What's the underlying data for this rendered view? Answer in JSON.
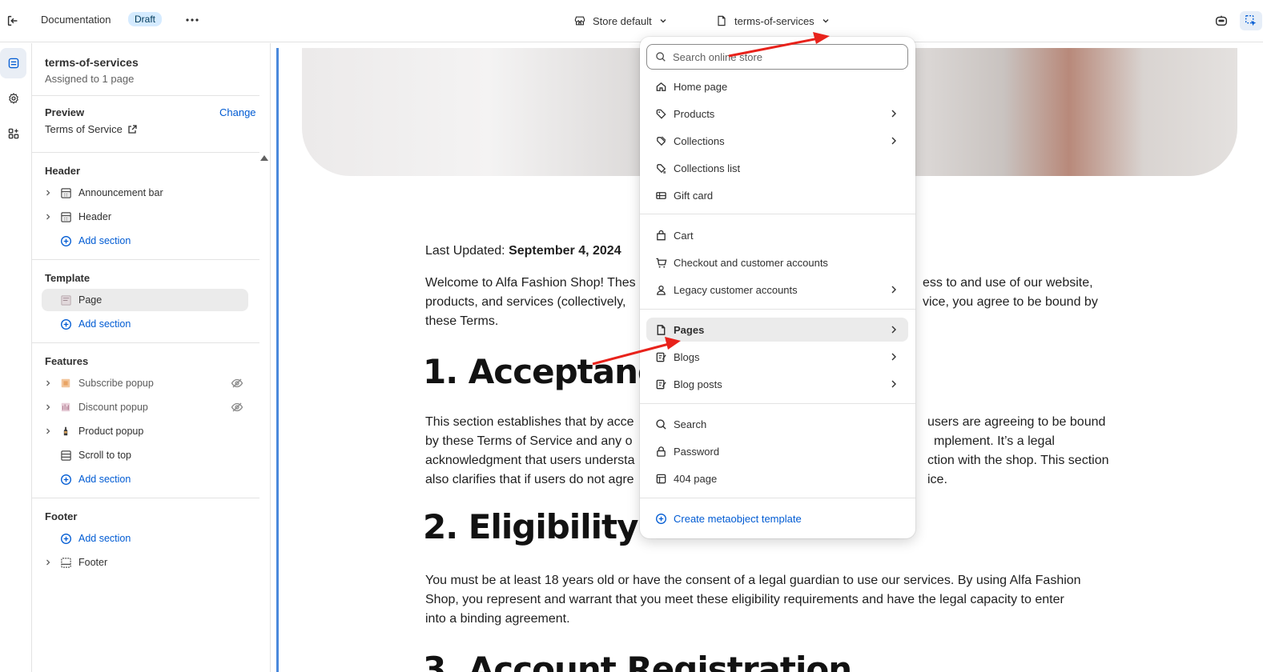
{
  "topbar": {
    "theme_name": "Documentation",
    "status_badge": "Draft",
    "store_select": "Store default",
    "template_select": "terms-of-services"
  },
  "sidebar": {
    "template_title": "terms-of-services",
    "assigned": "Assigned to 1 page",
    "preview_label": "Preview",
    "preview_change": "Change",
    "preview_page": "Terms of Service",
    "header_group": {
      "title": "Header",
      "items": [
        "Announcement bar",
        "Header"
      ],
      "add_label": "Add section"
    },
    "template_group": {
      "title": "Template",
      "items": [
        "Page"
      ],
      "add_label": "Add section"
    },
    "features_group": {
      "title": "Features",
      "items": [
        "Subscribe popup",
        "Discount popup",
        "Product popup",
        "Scroll to top"
      ],
      "add_label": "Add section"
    },
    "footer_group": {
      "title": "Footer",
      "add_label": "Add section",
      "items": [
        "Footer"
      ]
    }
  },
  "preview": {
    "last_updated_label": "Last Updated:",
    "last_updated_date": "September 4, 2024",
    "intro_1": "Welcome to Alfa Fashion Shop! Thes",
    "intro_1b": "ess to and use of our website,",
    "intro_2": "products, and services (collectively,",
    "intro_2b": "vice, you agree to be bound by",
    "intro_3": "these Terms.",
    "heading_1": "1. Acceptanc",
    "s1_l1": "This section establishes that by acce",
    "s1_l1b": "users are agreeing to be bound",
    "s1_l2": "by these Terms of Service and any o",
    "s1_l2b": "mplement. It’s a legal",
    "s1_l3": "acknowledgment that users understa",
    "s1_l3b": "ction with the shop. This section",
    "s1_l4": "also clarifies that if users do not agre",
    "s1_l4b": "ice.",
    "heading_2": "2. Eligibility",
    "s2_l1": "You must be at least 18 years old or have the consent of a legal guardian to use our services. By using Alfa Fashion",
    "s2_l2": "Shop, you represent and warrant that you meet these eligibility requirements and have the legal capacity to enter",
    "s2_l3": "into a binding agreement.",
    "heading_3": "3. Account Registration"
  },
  "dropdown": {
    "search_placeholder": "Search online store",
    "group1": [
      "Home page",
      "Products",
      "Collections",
      "Collections list",
      "Gift card"
    ],
    "group2": [
      "Cart",
      "Checkout and customer accounts",
      "Legacy customer accounts"
    ],
    "group3": [
      "Pages",
      "Blogs",
      "Blog posts"
    ],
    "group4": [
      "Search",
      "Password",
      "404 page"
    ],
    "create_label": "Create metaobject template"
  },
  "colors": {
    "accent": "#005bd3",
    "annotation_arrow": "#e8221b"
  }
}
